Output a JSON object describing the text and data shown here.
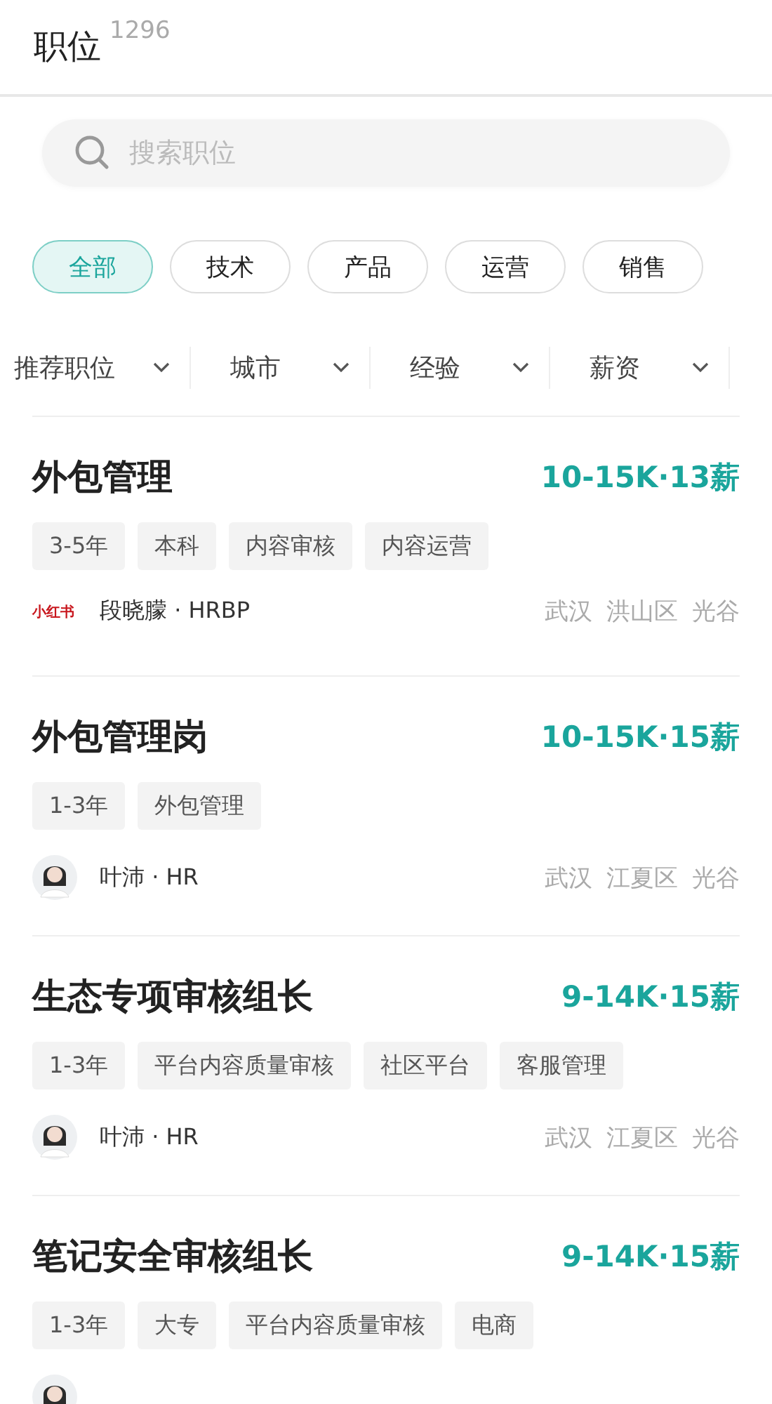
{
  "header": {
    "title": "职位",
    "count": "1296"
  },
  "search": {
    "placeholder": "搜索职位"
  },
  "categories": [
    {
      "label": "全部",
      "selected": true
    },
    {
      "label": "技术",
      "selected": false
    },
    {
      "label": "产品",
      "selected": false
    },
    {
      "label": "运营",
      "selected": false
    },
    {
      "label": "销售",
      "selected": false
    }
  ],
  "filters": [
    {
      "label": "推荐职位"
    },
    {
      "label": "城市"
    },
    {
      "label": "经验"
    },
    {
      "label": "薪资"
    }
  ],
  "jobs": [
    {
      "title": "外包管理",
      "salary": "10-15K·13薪",
      "tags": [
        "3-5年",
        "本科",
        "内容审核",
        "内容运营"
      ],
      "recruiter": {
        "kind": "logo",
        "logo_text": "小红书",
        "name": "段晓朦 · HRBP"
      },
      "location": [
        "武汉",
        "洪山区",
        "光谷"
      ]
    },
    {
      "title": "外包管理岗",
      "salary": "10-15K·15薪",
      "tags": [
        "1-3年",
        "外包管理"
      ],
      "recruiter": {
        "kind": "avatar",
        "name": "叶沛 · HR"
      },
      "location": [
        "武汉",
        "江夏区",
        "光谷"
      ]
    },
    {
      "title": "生态专项审核组长",
      "salary": "9-14K·15薪",
      "tags": [
        "1-3年",
        "平台内容质量审核",
        "社区平台",
        "客服管理"
      ],
      "recruiter": {
        "kind": "avatar",
        "name": "叶沛 · HR"
      },
      "location": [
        "武汉",
        "江夏区",
        "光谷"
      ]
    },
    {
      "title": "笔记安全审核组长",
      "salary": "9-14K·15薪",
      "tags": [
        "1-3年",
        "大专",
        "平台内容质量审核",
        "电商"
      ],
      "recruiter": {
        "kind": "avatar"
      }
    }
  ]
}
